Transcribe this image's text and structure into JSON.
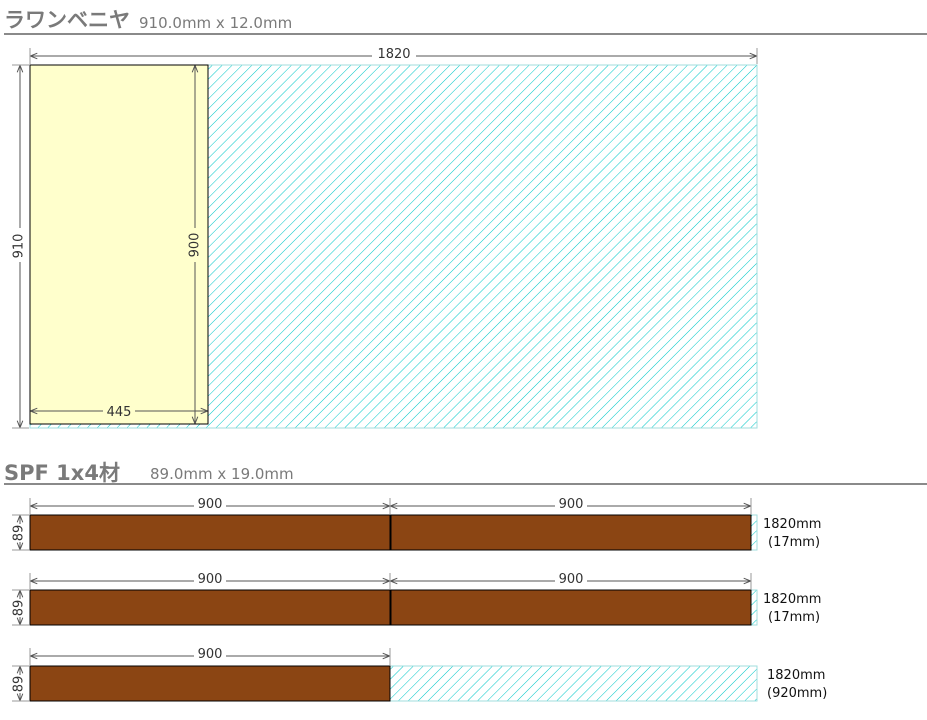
{
  "sections": [
    {
      "title": "ラワンベニヤ",
      "spec": "910.0mm x 12.0mm",
      "sheet": {
        "width": "1820",
        "height": "910"
      },
      "part": {
        "width": "445",
        "height": "900"
      }
    },
    {
      "title": "SPF 1x4材",
      "spec": "89.0mm x 19.0mm",
      "boards": [
        {
          "width_label": "89",
          "cuts": [
            "900",
            "900"
          ],
          "length": "1820mm",
          "remainder": "(17mm)"
        },
        {
          "width_label": "89",
          "cuts": [
            "900",
            "900"
          ],
          "length": "1820mm",
          "remainder": "(17mm)"
        },
        {
          "width_label": "89",
          "cuts": [
            "900"
          ],
          "length": "1820mm",
          "remainder": "(920mm)"
        }
      ]
    }
  ],
  "colors": {
    "part_fill": "#ffffcc",
    "board_fill": "#8b4513",
    "hatch": "#00c8c8",
    "dim_line": "#999999"
  }
}
